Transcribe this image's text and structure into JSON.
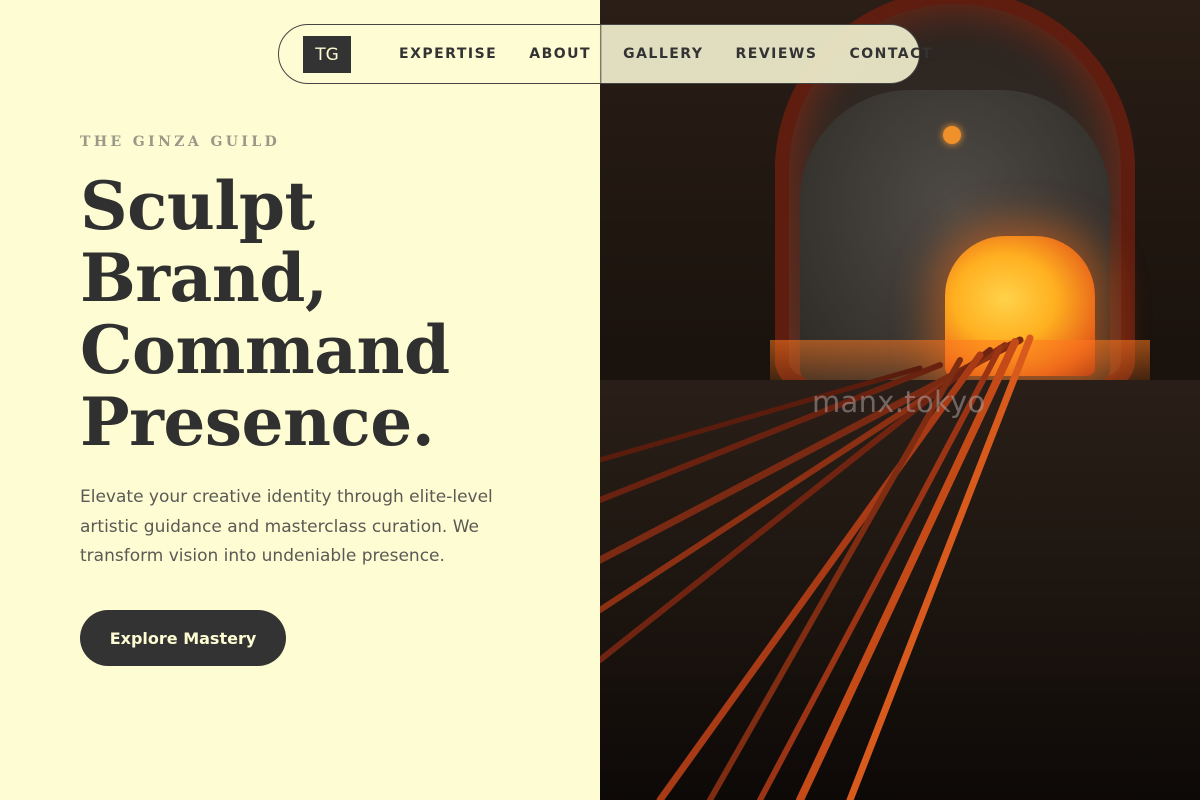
{
  "nav": {
    "logo": "TG",
    "links": [
      "EXPERTISE",
      "ABOUT",
      "GALLERY",
      "REVIEWS",
      "CONTACT"
    ]
  },
  "hero": {
    "eyebrow": "THE GINZA GUILD",
    "headline": [
      "Sculpt",
      "Brand,",
      "Command",
      "Presence."
    ],
    "description": "Elevate your creative identity through elite-level artistic guidance and masterclass curation. We transform vision into undeniable presence.",
    "cta_label": "Explore Mastery"
  },
  "image": {
    "watermark": "manx.tokyo"
  },
  "colors": {
    "background": "#fefcd2",
    "text_dark": "#303030",
    "button_bg": "#333333",
    "eyebrow": "#9a9886",
    "fire_orange": "#ffb020"
  }
}
